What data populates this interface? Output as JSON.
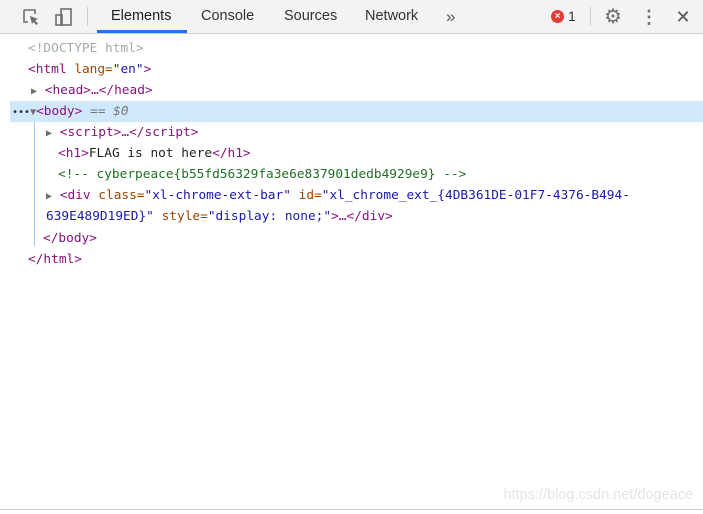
{
  "toolbar": {
    "tabs": [
      "Elements",
      "Console",
      "Sources",
      "Network"
    ],
    "active_tab": "Elements",
    "more_tabs": "»",
    "error_count": "1",
    "accent": "#1a73e8"
  },
  "dom": {
    "doctype": "<!DOCTYPE html>",
    "html_open": {
      "tag": "<html",
      "attr": " lang=",
      "val": "\"en\"",
      "close": ">"
    },
    "head": "<head>…</head>",
    "body_open": "<body>",
    "body_selected": " == $0",
    "script": "<script>…</script>",
    "h1_open": "<h1>",
    "h1_text": "FLAG is not here",
    "h1_close": "</h1>",
    "comment": "<!-- cyberpeace{b55fd56329fa3e6e837901dedb4929e9} -->",
    "div": {
      "open": "<div",
      "a1": " class=",
      "v1": "\"xl-chrome-ext-bar\"",
      "a2": " id=",
      "v2a": "\"xl_chrome_ext_{4DB361DE-01F7-4376-B494-",
      "v2b": "639E489D19ED}\"",
      "a3": " style=",
      "v3": "\"display: none;\"",
      "rest": ">…</div>"
    },
    "body_close": "</body>",
    "html_close": "</html>"
  },
  "watermark": "https://blog.csdn.net/dogeace"
}
